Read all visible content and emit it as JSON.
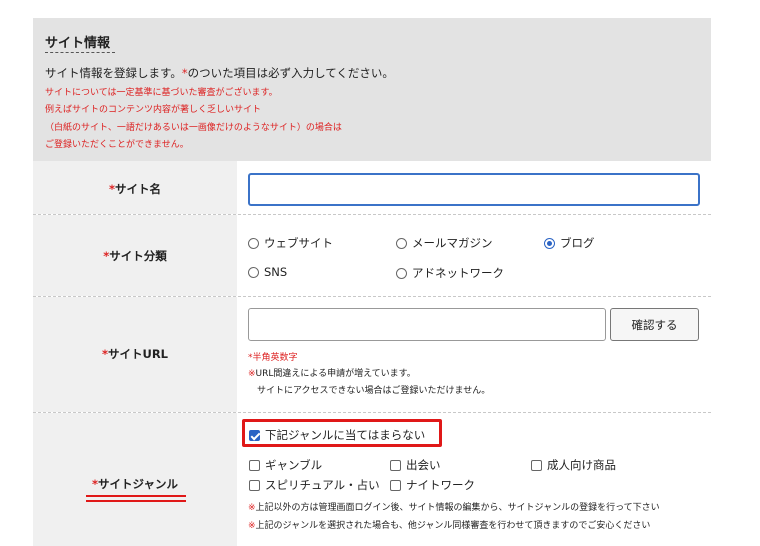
{
  "header": {
    "title": "サイト情報",
    "intro_pre": "サイト情報を登録します。",
    "intro_star": "*",
    "intro_post": "のついた項目は必ず入力してください。",
    "warnings": [
      "サイトについては一定基準に基づいた審査がございます。",
      "例えばサイトのコンテンツ内容が著しく乏しいサイト",
      "（白紙のサイト、一語だけあるいは一画像だけのようなサイト）の場合は",
      "ご登録いただくことができません。"
    ]
  },
  "required_mark": "*",
  "site_name": {
    "label": "サイト名",
    "value": "",
    "placeholder": ""
  },
  "site_category": {
    "label": "サイト分類",
    "options": [
      {
        "label": "ウェブサイト",
        "checked": false
      },
      {
        "label": "メールマガジン",
        "checked": false
      },
      {
        "label": "ブログ",
        "checked": true
      },
      {
        "label": "SNS",
        "checked": false
      },
      {
        "label": "アドネットワーク",
        "checked": false
      }
    ]
  },
  "site_url": {
    "label": "サイトURL",
    "value": "",
    "confirm_button": "確認する",
    "hint": "*半角英数字",
    "note_mark": "※",
    "note_line1": "URL間違えによる申請が増えています。",
    "note_line2": "サイトにアクセスできない場合はご登録いただけません。"
  },
  "site_genre": {
    "label": "サイトジャンル",
    "not_applicable": {
      "label": "下記ジャンルに当てはまらない",
      "checked": true
    },
    "options": [
      {
        "label": "ギャンブル",
        "checked": false
      },
      {
        "label": "出会い",
        "checked": false
      },
      {
        "label": "成人向け商品",
        "checked": false
      },
      {
        "label": "スピリチュアル・占い",
        "checked": false
      },
      {
        "label": "ナイトワーク",
        "checked": false
      }
    ],
    "note_mark": "※",
    "note1": "上記以外の方は管理画面ログイン後、サイト情報の編集から、サイトジャンルの登録を行って下さい",
    "note2": "上記のジャンルを選択された場合も、他ジャンル同様審査を行わせて頂きますのでご安心ください"
  },
  "colors": {
    "accent": "#2a63c4",
    "required": "#dd2222",
    "highlight": "#e01818",
    "header_bg": "#e3e3e3",
    "label_bg": "#f0f0f0"
  }
}
